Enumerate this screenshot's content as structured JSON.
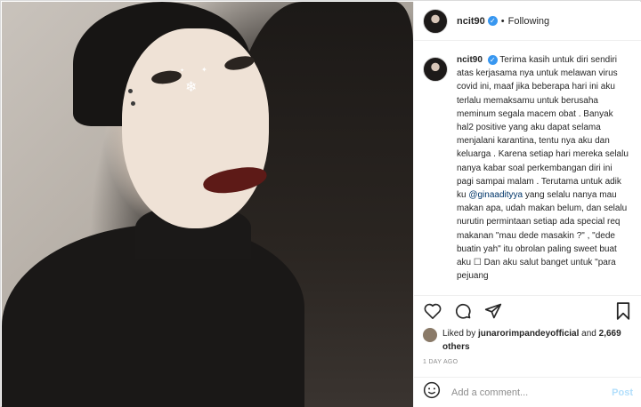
{
  "post": {
    "username": "ncit90",
    "follow_status": "Following",
    "separator": "•",
    "verified_mark": "✓"
  },
  "caption": {
    "username": "ncit90",
    "text_before_mention": "Terima kasih untuk diri sendiri atas kerjasama nya untuk melawan virus covid ini, maaf jika beberapa hari ini aku terlalu memaksamu untuk berusaha meminum segala macem obat . Banyak hal2 positive yang aku dapat selama menjalani karantina, tentu nya aku dan keluarga . Karena setiap hari mereka selalu nanya kabar soal perkembangan diri ini pagi sampai malam . Terutama untuk adik ku",
    "mention": "@ginaadityya",
    "text_after_mention": "yang selalu nanya mau makan apa, udah makan belum, dan selalu nurutin permintaan setiap ada special req makanan \"mau dede masakin ?\" , \"dede buatin yah\" itu obrolan paling sweet buat aku ☐ Dan aku salut banget untuk \"para pejuang"
  },
  "likes": {
    "prefix": "Liked by",
    "user": "junarorimpandeyofficial",
    "connector": "and",
    "others": "2,669 others"
  },
  "timestamp": "1 DAY AGO",
  "comment_box": {
    "placeholder": "Add a comment...",
    "post_label": "Post"
  },
  "icons": {
    "like": "heart-icon",
    "comment": "comment-icon",
    "share": "share-icon",
    "save": "bookmark-icon",
    "emoji": "smiley-icon",
    "verified": "verified-badge-icon"
  },
  "colors": {
    "verified_blue": "#3897f0",
    "post_button_disabled": "#b2dffc",
    "muted_text": "#8e8e8e",
    "mention": "#003569"
  }
}
